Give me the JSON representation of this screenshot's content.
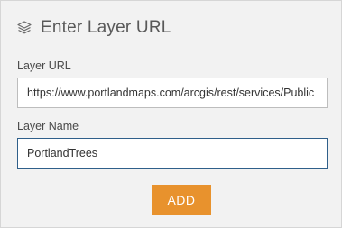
{
  "header": {
    "icon": "layers-icon",
    "title": "Enter Layer URL"
  },
  "form": {
    "url_label": "Layer URL",
    "url_value": "https://www.portlandmaps.com/arcgis/rest/services/Public",
    "name_label": "Layer Name",
    "name_value": "PortlandTrees"
  },
  "actions": {
    "add_label": "ADD"
  },
  "colors": {
    "panel_bg": "#f2f2f2",
    "accent_button": "#e8922d",
    "focused_border": "#2f5f8a"
  }
}
